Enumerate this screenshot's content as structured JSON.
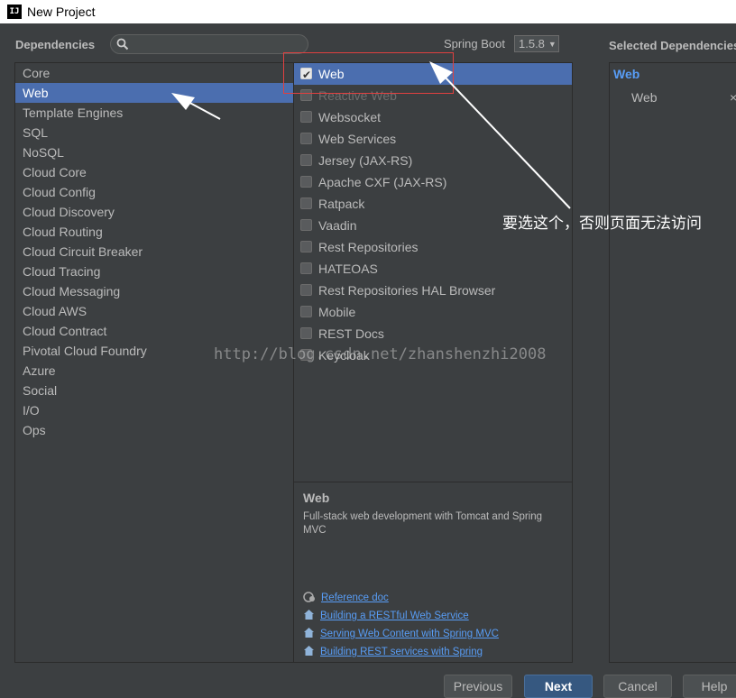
{
  "window": {
    "title": "New Project",
    "icon_text": "IJ"
  },
  "header": {
    "dependencies_label": "Dependencies",
    "search_placeholder": "",
    "spring_boot_label": "Spring Boot",
    "spring_boot_version": "1.5.8",
    "selected_label": "Selected Dependencies"
  },
  "categories": [
    {
      "label": "Core"
    },
    {
      "label": "Web"
    },
    {
      "label": "Template Engines"
    },
    {
      "label": "SQL"
    },
    {
      "label": "NoSQL"
    },
    {
      "label": "Cloud Core"
    },
    {
      "label": "Cloud Config"
    },
    {
      "label": "Cloud Discovery"
    },
    {
      "label": "Cloud Routing"
    },
    {
      "label": "Cloud Circuit Breaker"
    },
    {
      "label": "Cloud Tracing"
    },
    {
      "label": "Cloud Messaging"
    },
    {
      "label": "Cloud AWS"
    },
    {
      "label": "Cloud Contract"
    },
    {
      "label": "Pivotal Cloud Foundry"
    },
    {
      "label": "Azure"
    },
    {
      "label": "Social"
    },
    {
      "label": "I/O"
    },
    {
      "label": "Ops"
    }
  ],
  "selected_category_index": 1,
  "dependencies": [
    {
      "label": "Web",
      "checked": true,
      "selected": true
    },
    {
      "label": "Reactive Web",
      "checked": false,
      "disabled": true
    },
    {
      "label": "Websocket",
      "checked": false
    },
    {
      "label": "Web Services",
      "checked": false
    },
    {
      "label": "Jersey (JAX-RS)",
      "checked": false
    },
    {
      "label": "Apache CXF (JAX-RS)",
      "checked": false
    },
    {
      "label": "Ratpack",
      "checked": false
    },
    {
      "label": "Vaadin",
      "checked": false
    },
    {
      "label": "Rest Repositories",
      "checked": false
    },
    {
      "label": "HATEOAS",
      "checked": false
    },
    {
      "label": "Rest Repositories HAL Browser",
      "checked": false
    },
    {
      "label": "Mobile",
      "checked": false
    },
    {
      "label": "REST Docs",
      "checked": false
    },
    {
      "label": "Keycloak",
      "checked": false
    }
  ],
  "description": {
    "title": "Web",
    "text": "Full-stack web development with Tomcat and Spring MVC",
    "links": [
      {
        "label": "Reference doc",
        "icon": "reference-doc-icon"
      },
      {
        "label": "Building a RESTful Web Service",
        "icon": "guide-home-icon"
      },
      {
        "label": "Serving Web Content with Spring MVC",
        "icon": "guide-home-icon"
      },
      {
        "label": "Building REST services with Spring",
        "icon": "guide-home-icon"
      }
    ]
  },
  "selected": {
    "group": "Web",
    "items": [
      {
        "label": "Web",
        "remove": "×"
      }
    ]
  },
  "buttons": {
    "previous": "Previous",
    "next": "Next",
    "cancel": "Cancel",
    "help": "Help"
  },
  "annotation": {
    "text": "要选这个，否则页面无法访问"
  },
  "watermark": "http://blog.csdn.net/zhanshenzhi2008",
  "colors": {
    "selection": "#4b6eaf",
    "link": "#589df6",
    "background": "#3c3f41",
    "annotation_box": "#e04040"
  }
}
